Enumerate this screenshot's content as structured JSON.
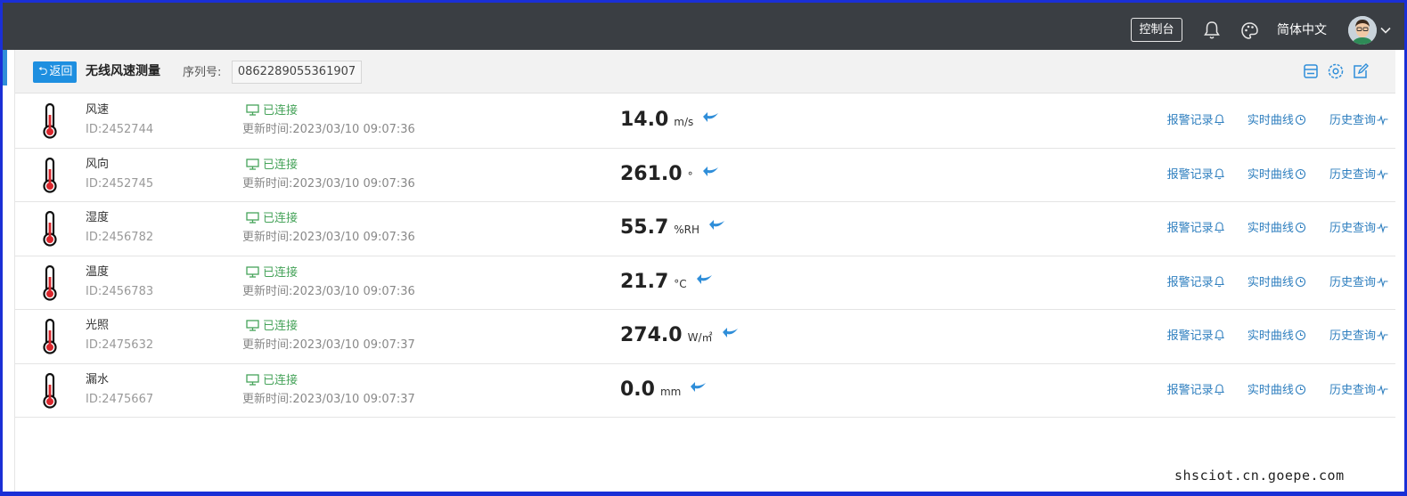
{
  "topbar": {
    "console_label": "控制台",
    "language_label": "简体中文",
    "icons": [
      "bell-icon",
      "palette-icon",
      "avatar",
      "chevron-down-icon"
    ]
  },
  "subheader": {
    "back_label": "返回",
    "title": "无线风速测量",
    "serial_label": "序列号:",
    "serial_value": "0862289055361907",
    "icons": [
      "storage-icon",
      "settings-icon",
      "edit-icon"
    ]
  },
  "sensors": [
    {
      "name": "风速",
      "id": "ID:2452744",
      "status": "已连接",
      "updated": "更新时间:2023/03/10 09:07:36",
      "value": "14.0",
      "unit": "m/s"
    },
    {
      "name": "风向",
      "id": "ID:2452745",
      "status": "已连接",
      "updated": "更新时间:2023/03/10 09:07:36",
      "value": "261.0",
      "unit": "°"
    },
    {
      "name": "湿度",
      "id": "ID:2456782",
      "status": "已连接",
      "updated": "更新时间:2023/03/10 09:07:36",
      "value": "55.7",
      "unit": "%RH"
    },
    {
      "name": "温度",
      "id": "ID:2456783",
      "status": "已连接",
      "updated": "更新时间:2023/03/10 09:07:36",
      "value": "21.7",
      "unit": "°C"
    },
    {
      "name": "光照",
      "id": "ID:2475632",
      "status": "已连接",
      "updated": "更新时间:2023/03/10 09:07:37",
      "value": "274.0",
      "unit": "W/㎡"
    },
    {
      "name": "漏水",
      "id": "ID:2475667",
      "status": "已连接",
      "updated": "更新时间:2023/03/10 09:07:37",
      "value": "0.0",
      "unit": "mm"
    }
  ],
  "actions": {
    "alarm_label": "报警记录",
    "realtime_label": "实时曲线",
    "history_label": "历史查询"
  },
  "colors": {
    "topbar": "#3a3e43",
    "accent": "#1e8fe0",
    "connected": "#46a35a",
    "link": "#2f7fbf"
  },
  "watermark": "shsciot.cn.goepe.com"
}
